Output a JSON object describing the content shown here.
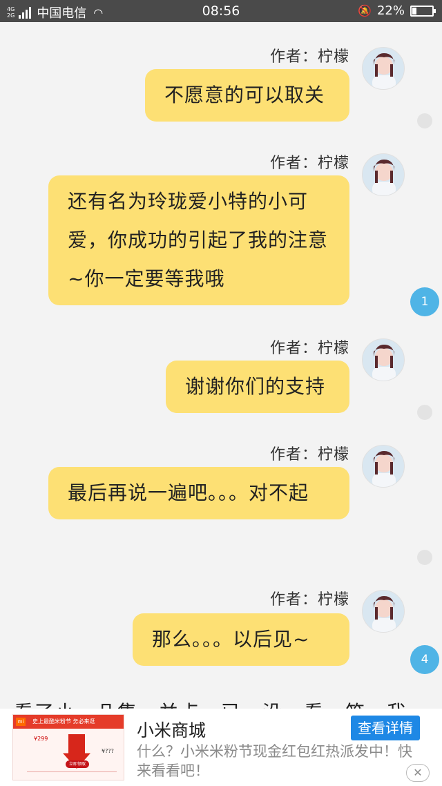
{
  "status_bar": {
    "network": "4G\n2G",
    "carrier": "中国电信",
    "time": "08:56",
    "battery": "22%",
    "battery_level": 0.22,
    "icons": [
      "signal-icon",
      "wifi-icon",
      "bell-muted-icon",
      "battery-icon"
    ]
  },
  "messages": [
    {
      "author": "作者：柠檬",
      "text": "不愿意的可以取关",
      "badge": ""
    },
    {
      "author": "作者：柠檬",
      "text": "还有名为玲珑爱小特的小可爱，你成功的引起了我的注意~你一定要等我哦",
      "badge": "1"
    },
    {
      "author": "作者：柠檬",
      "text": "谢谢你们的支持",
      "badge": ""
    },
    {
      "author": "作者：柠檬",
      "text": "最后再说一遍吧。。。对不起",
      "badge": ""
    },
    {
      "author": "作者：柠檬",
      "text": "那么。。。以后见~",
      "badge": "4"
    }
  ],
  "cutoff_text": "看了小…几集…并点…已…没…看…笑…我…",
  "ad": {
    "title": "小米商城",
    "description": "什么？小米米粉节现金红包红热派发中！快来看看吧！",
    "cta": "查看详情",
    "close": "✕",
    "image": {
      "logo": "mi",
      "banner": "史上最酷米粉节 务必来逛",
      "price": "¥299",
      "button": "立即领取",
      "amount": "5000万\n现金红包",
      "question": "¥???"
    }
  },
  "colors": {
    "bubble": "#fde074",
    "badge": "#4fb4e6",
    "ad_button": "#1e88e5"
  }
}
